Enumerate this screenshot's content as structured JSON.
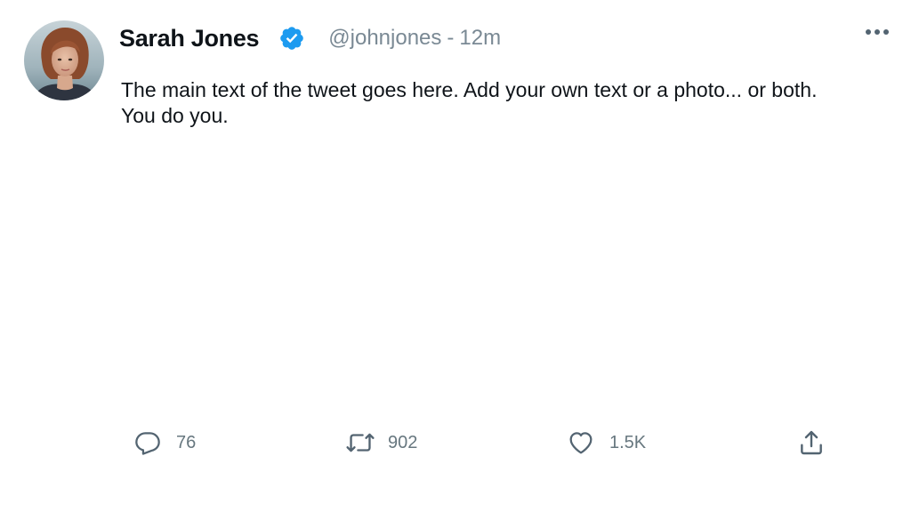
{
  "tweet": {
    "author": {
      "display_name": "Sarah Jones",
      "verified": true,
      "handle": "@johnjones",
      "separator": "-",
      "time": "12m"
    },
    "text": "The main text of the tweet goes here. Add your own text or a photo... or both. You do you.",
    "actions": {
      "reply_count": "76",
      "retweet_count": "902",
      "like_count": "1.5K"
    }
  },
  "icons": {
    "verified": "verified-badge-icon",
    "more": "more-horizontal-icon",
    "reply": "reply-icon",
    "retweet": "retweet-icon",
    "like": "heart-icon",
    "share": "share-icon"
  },
  "colors": {
    "verified_blue": "#1d9bf0",
    "secondary_text": "#7a8994",
    "icon_gray": "#536471"
  }
}
